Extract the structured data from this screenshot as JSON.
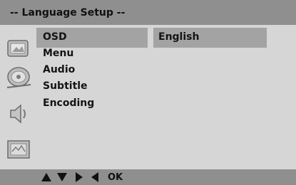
{
  "header": {
    "title": "-- Language Setup --"
  },
  "menu": {
    "items": [
      {
        "label": "OSD"
      },
      {
        "label": "Menu"
      },
      {
        "label": "Audio"
      },
      {
        "label": "Subtitle"
      },
      {
        "label": "Encoding"
      }
    ],
    "selected_index": 0
  },
  "value": {
    "label": "English"
  },
  "sidebar": {
    "icons": [
      "general-setup-icon",
      "speaker-setup-icon",
      "audio-setup-icon",
      "preference-icon"
    ]
  },
  "footer": {
    "ok_label": "OK"
  }
}
